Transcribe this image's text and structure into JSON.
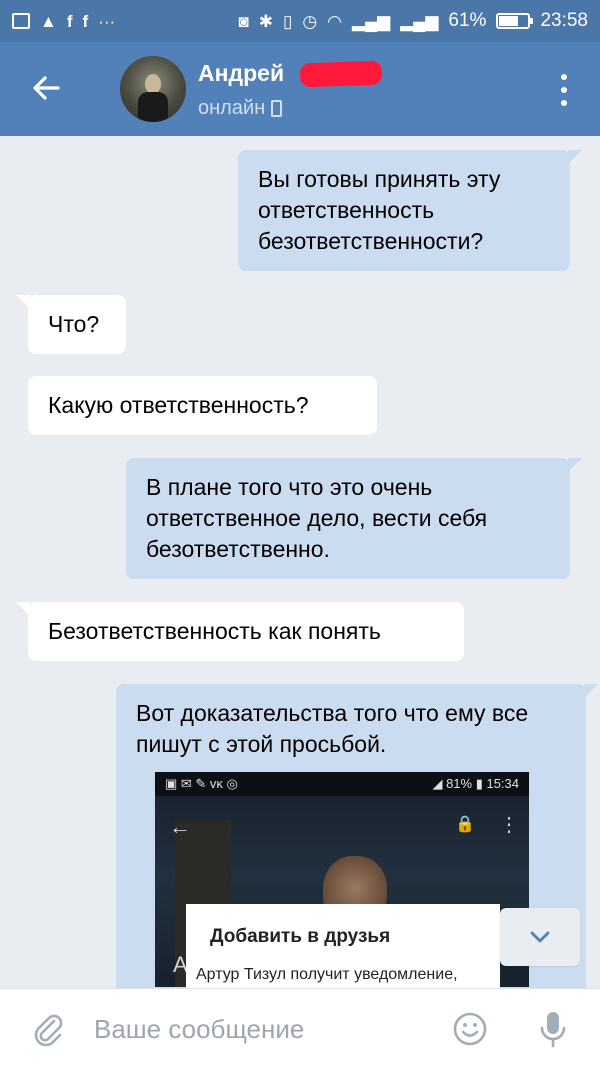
{
  "statusbar": {
    "battery_percent": "61%",
    "time": "23:58",
    "icons": [
      "image-icon",
      "warning-icon",
      "facebook-icon",
      "facebook-icon",
      "more-icon",
      "nfc-icon",
      "bluetooth-icon",
      "vibrate-icon",
      "alarm-icon",
      "wifi-icon",
      "signal-icon",
      "signal-icon",
      "battery-icon"
    ],
    "more_label": "···"
  },
  "header": {
    "name": "Андрей",
    "status": "онлайн",
    "accent_color": "#5181b8"
  },
  "messages": [
    {
      "direction": "out",
      "text": "Вы готовы принять эту ответственность безответственности?"
    },
    {
      "direction": "in",
      "text": "Что?"
    },
    {
      "direction": "in",
      "text": "Какую ответственность?"
    },
    {
      "direction": "out",
      "text": "В плане того что это очень ответственное дело, вести себя безответственно."
    },
    {
      "direction": "in",
      "text": "Безответственность как понять"
    },
    {
      "direction": "out",
      "text": "Вот доказательства того что ему все пишут с этой просьбой."
    }
  ],
  "attachment": {
    "statusbar_left": "▣ ✉ ✎ ᴠᴋ ◎",
    "statusbar_right": "◢ 81% ▮ 15:34",
    "letter": "А",
    "popup_title": "Добавить в друзья",
    "popup_text": "Артур Тизул получит уведомление,"
  },
  "input": {
    "placeholder": "Ваше сообщение"
  }
}
